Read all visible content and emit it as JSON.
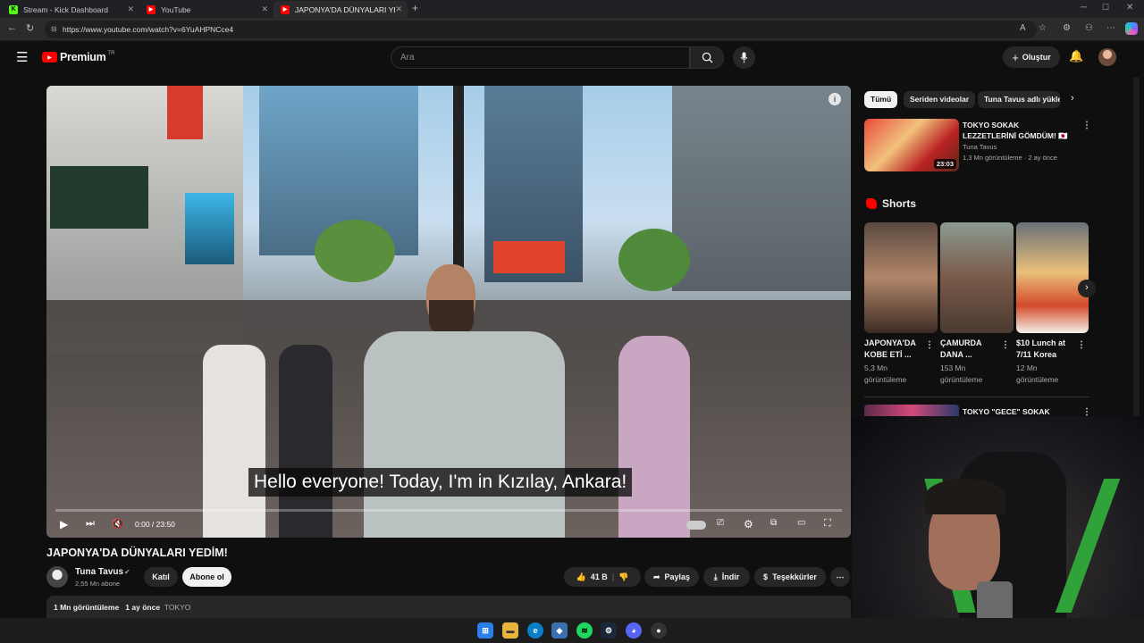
{
  "browser": {
    "tabs": [
      {
        "label": "Stream - Kick Dashboard",
        "icon": "kick-icon",
        "active": false
      },
      {
        "label": "YouTube",
        "icon": "youtube-icon",
        "active": false
      },
      {
        "label": "JAPONYA'DA DÜNYALARI YEDİM!",
        "icon": "youtube-icon",
        "active": true
      }
    ],
    "url": "https://www.youtube.com/watch?v=6YuAHPNCce4"
  },
  "masthead": {
    "logo": "Premium",
    "region": "TR",
    "search_placeholder": "Ara",
    "create_label": "Oluştur"
  },
  "player": {
    "subtitle": "Hello everyone! Today, I'm in Kızılay, Ankara!",
    "time": "0:00 / 23:50",
    "progress": 0
  },
  "video": {
    "title": "JAPONYA'DA DÜNYALARI YEDİM!",
    "channel": "Tuna Tavus",
    "subscribers": "2,55 Mn abone",
    "join_label": "Katıl",
    "subscribe_label": "Abone ol",
    "likes": "41 B",
    "share_label": "Paylaş",
    "download_label": "İndir",
    "thanks_label": "Teşekkürler",
    "views": "1 Mn görüntüleme",
    "date": "1 ay önce",
    "tag": "TOKYO"
  },
  "sidebar": {
    "chips": [
      "Tümü",
      "Seriden videolar",
      "Tuna Tavus adlı yükleyiciden"
    ],
    "recommended": {
      "title": "TOKYO SOKAK LEZZETLERİNİ GÖMDÜM! 🇯🇵",
      "channel": "Tuna Tavus",
      "meta": "1,3 Mn görüntüleme · 2 ay önce",
      "duration": "23:03"
    },
    "shorts_header": "Shorts",
    "shorts": [
      {
        "title": "JAPONYA'DA KOBE ETİ ...",
        "views": "5,3 Mn görüntüleme"
      },
      {
        "title": "ÇAMURDA DANA ...",
        "views": "153 Mn görüntüleme"
      },
      {
        "title": "$10 Lunch at 7/11 Korea",
        "views": "12 Mn görüntüleme"
      }
    ],
    "next_title": "TOKYO \"GECE\" SOKAK"
  },
  "colors": {
    "brand_red": "#ff0000",
    "chip_active_bg": "#f1f1f1",
    "dark_bg": "#0f0f0f"
  }
}
